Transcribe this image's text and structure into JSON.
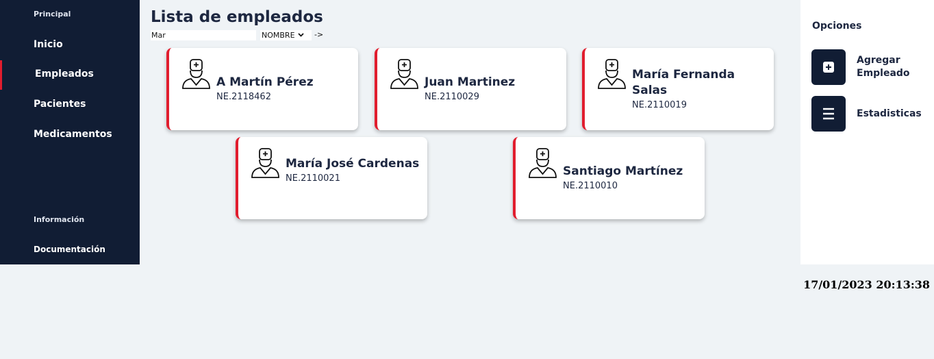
{
  "sidebar": {
    "section_principal": "Principal",
    "items": [
      {
        "label": "Inicio"
      },
      {
        "label": "Empleados"
      },
      {
        "label": "Pacientes"
      },
      {
        "label": "Medicamentos"
      }
    ],
    "section_info": "Información",
    "doc_label": "Documentación"
  },
  "main": {
    "title": "Lista de empleados",
    "search": {
      "value": "Mar"
    },
    "sort": {
      "selected": "NOMBRE"
    },
    "go_label": "->",
    "employees": [
      {
        "name": "A Martín Pérez",
        "code": "NE.2118462",
        "icon": "doctor-icon"
      },
      {
        "name": "Juan Martinez",
        "code": "NE.2110029",
        "icon": "doctor-icon"
      },
      {
        "name": "María Fernanda Salas",
        "code": "NE.2110019",
        "icon": "doctor-icon"
      },
      {
        "name": "María José Cardenas",
        "code": "NE.2110021",
        "icon": "doctor-icon"
      },
      {
        "name": "Santiago Martínez",
        "code": "NE.2110010",
        "icon": "doctor-icon"
      }
    ]
  },
  "options": {
    "title": "Opciones",
    "add_employee": {
      "label": "Agregar Empleado",
      "icon": "plus-icon"
    },
    "stats": {
      "label": "Estadisticas",
      "icon": "menu-icon"
    }
  },
  "datetime": "17/01/2023 20:13:38",
  "colors": {
    "sidebar": "#111d34",
    "accent": "#e11d2e",
    "text": "#1d2740",
    "background": "#eff3f6"
  }
}
